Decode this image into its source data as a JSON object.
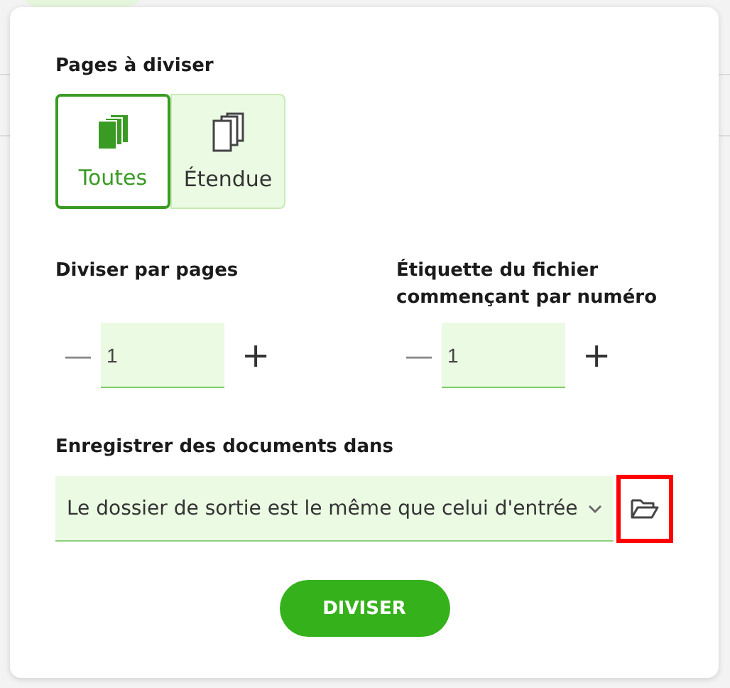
{
  "pages_section": {
    "label": "Pages à diviser",
    "options": [
      {
        "label": "Toutes",
        "kind": "all",
        "selected": true
      },
      {
        "label": "Étendue",
        "kind": "range",
        "selected": false
      }
    ]
  },
  "spinners": [
    {
      "label": "Diviser par pages",
      "value": "1",
      "minus": "—",
      "plus": "+"
    },
    {
      "label": "Étiquette du fichier commençant par numéro",
      "value": "1",
      "minus": "—",
      "plus": "+"
    }
  ],
  "output": {
    "label": "Enregistrer des documents dans",
    "value": "Le dossier de sortie est le même que celui d'entrée",
    "folder_button_highlighted": true
  },
  "action_button": "DIVISER"
}
